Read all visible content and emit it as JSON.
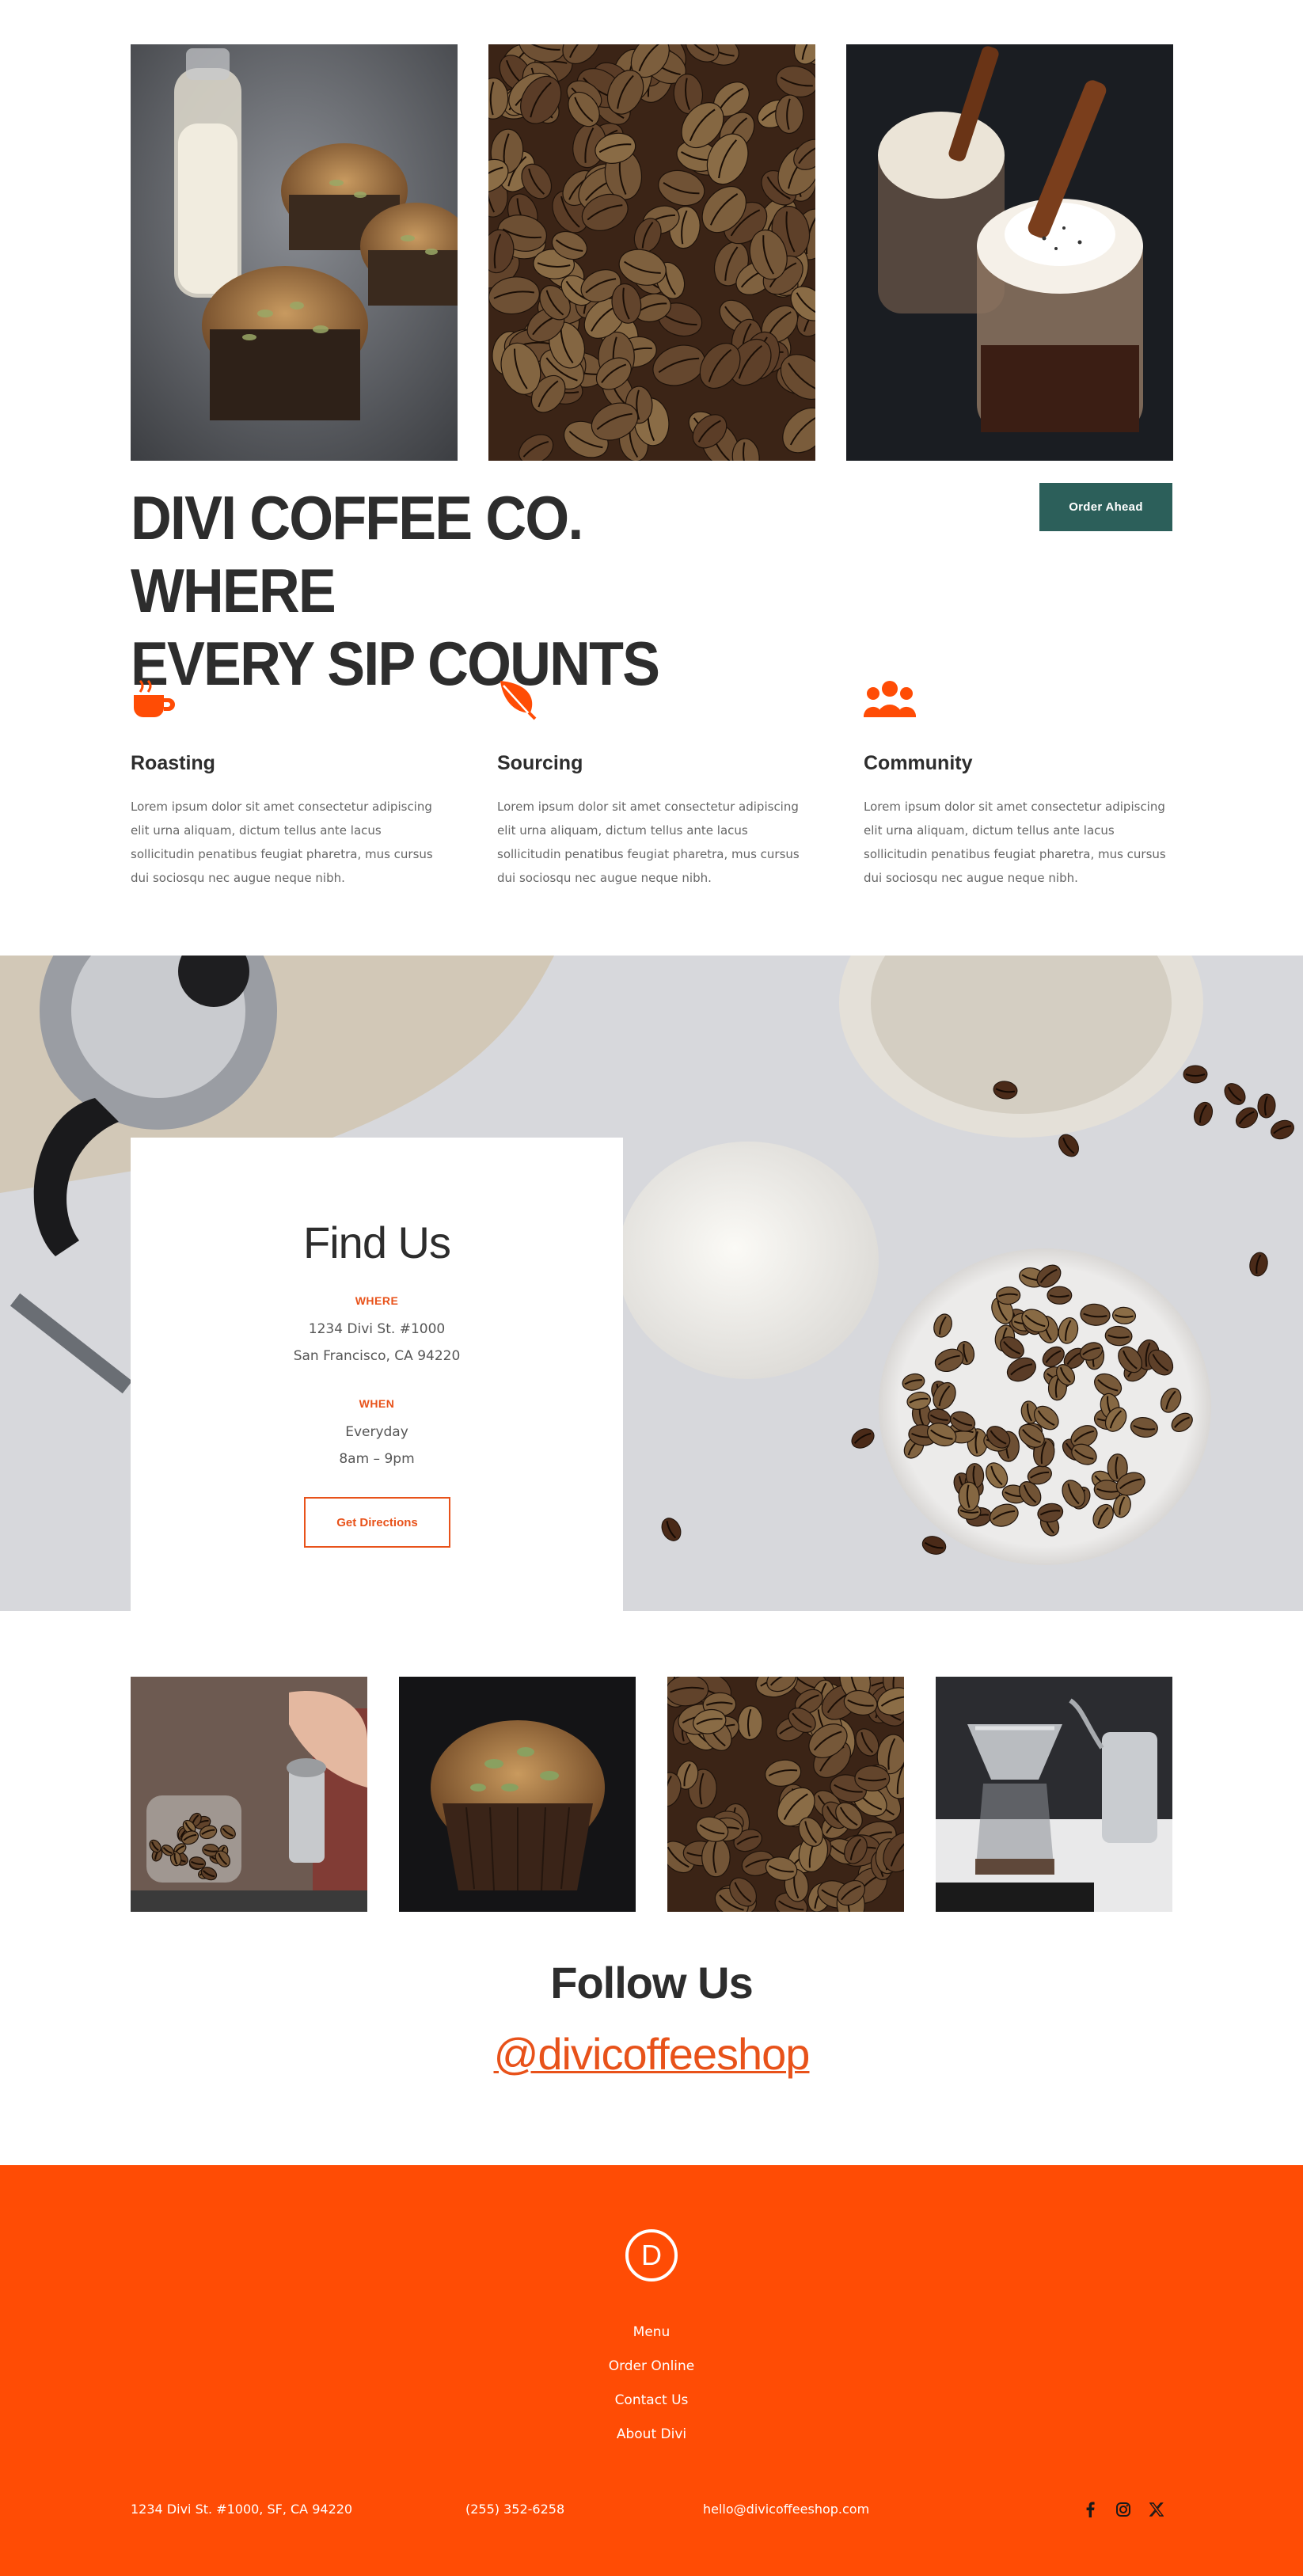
{
  "hero": {
    "title_line1": "DIVI COFFEE CO. WHERE",
    "title_line2": "EVERY SIP COUNTS",
    "order_button": "Order Ahead"
  },
  "features": [
    {
      "icon": "coffee-cup-icon",
      "title": "Roasting",
      "text": "Lorem ipsum dolor sit amet consectetur adipiscing elit urna aliquam, dictum tellus ante lacus sollicitudin penatibus feugiat pharetra, mus cursus dui sociosqu nec augue neque nibh."
    },
    {
      "icon": "leaf-icon",
      "title": "Sourcing",
      "text": "Lorem ipsum dolor sit amet consectetur adipiscing elit urna aliquam, dictum tellus ante lacus sollicitudin penatibus feugiat pharetra, mus cursus dui sociosqu nec augue neque nibh."
    },
    {
      "icon": "users-icon",
      "title": "Community",
      "text": "Lorem ipsum dolor sit amet consectetur adipiscing elit urna aliquam, dictum tellus ante lacus sollicitudin penatibus feugiat pharetra, mus cursus dui sociosqu nec augue neque nibh."
    }
  ],
  "find_us": {
    "title": "Find Us",
    "where_label": "WHERE",
    "address_line1": "1234 Divi St. #1000",
    "address_line2": "San Francisco, CA 94220",
    "when_label": "WHEN",
    "hours_line1": "Everyday",
    "hours_line2": "8am – 9pm",
    "directions_button": "Get Directions"
  },
  "follow": {
    "title": "Follow Us",
    "handle": "@divicoffeeshop"
  },
  "footer": {
    "logo_letter": "D",
    "menu": [
      "Menu",
      "Order Online",
      "Contact Us",
      "About Divi"
    ],
    "address": "1234 Divi St. #1000, SF, CA 94220",
    "phone": "(255) 352-6258",
    "email": "hello@divicoffeeshop.com",
    "social": [
      "facebook-icon",
      "instagram-icon",
      "x-twitter-icon"
    ]
  },
  "colors": {
    "accent": "#ff4c05",
    "accent_text": "#e8521a",
    "button_teal": "#2c5f5a",
    "heading": "#2d2d2d",
    "body_text": "#666666"
  }
}
